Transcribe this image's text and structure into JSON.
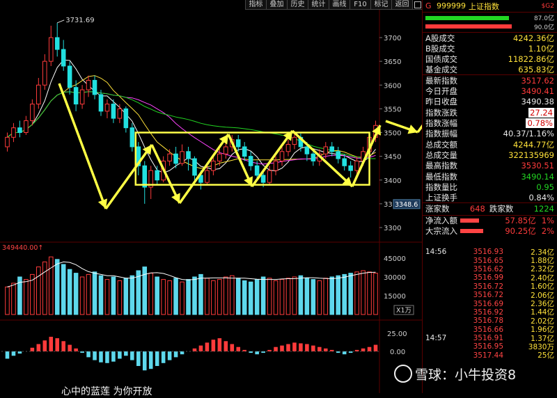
{
  "toolbar": {
    "buttons": [
      "指标",
      "叠加",
      "历史",
      "统计",
      "画线",
      "F10",
      "标记",
      "返回"
    ]
  },
  "chart_data": {
    "type": "candlestick",
    "y_ticks": [
      "3700",
      "3650",
      "3600",
      "3550",
      "3500",
      "3450",
      "3400",
      "3350",
      "3300"
    ],
    "y_values": [
      3700,
      3650,
      3600,
      3550,
      3500,
      3450,
      3400,
      3350,
      3300
    ],
    "high_label": "3731.69",
    "low_label": "3348.6",
    "current_price": 3517.62,
    "box": {
      "top": 3500,
      "bottom": 3390
    },
    "volume_ticks": [
      "45000",
      "30000",
      "15000"
    ],
    "volume_ticks_values": [
      45000,
      30000,
      15000
    ],
    "volume_label": "349440.00↑",
    "volume_unit": "X1万",
    "macd_ticks": [
      "25.00",
      "0.00"
    ],
    "candles": [
      {
        "o": 3470,
        "c": 3490,
        "h": 3500,
        "l": 3460
      },
      {
        "o": 3490,
        "c": 3510,
        "h": 3520,
        "l": 3480
      },
      {
        "o": 3510,
        "c": 3500,
        "h": 3525,
        "l": 3490
      },
      {
        "o": 3500,
        "c": 3525,
        "h": 3535,
        "l": 3495
      },
      {
        "o": 3525,
        "c": 3560,
        "h": 3570,
        "l": 3515
      },
      {
        "o": 3560,
        "c": 3600,
        "h": 3615,
        "l": 3550
      },
      {
        "o": 3600,
        "c": 3650,
        "h": 3665,
        "l": 3590
      },
      {
        "o": 3650,
        "c": 3700,
        "h": 3725,
        "l": 3640
      },
      {
        "o": 3700,
        "c": 3675,
        "h": 3731,
        "l": 3660
      },
      {
        "o": 3675,
        "c": 3640,
        "h": 3695,
        "l": 3630
      },
      {
        "o": 3640,
        "c": 3595,
        "h": 3650,
        "l": 3580
      },
      {
        "o": 3595,
        "c": 3560,
        "h": 3610,
        "l": 3545
      },
      {
        "o": 3560,
        "c": 3590,
        "h": 3600,
        "l": 3550
      },
      {
        "o": 3590,
        "c": 3610,
        "h": 3620,
        "l": 3575
      },
      {
        "o": 3610,
        "c": 3580,
        "h": 3620,
        "l": 3570
      },
      {
        "o": 3580,
        "c": 3545,
        "h": 3590,
        "l": 3535
      },
      {
        "o": 3545,
        "c": 3560,
        "h": 3570,
        "l": 3530
      },
      {
        "o": 3560,
        "c": 3530,
        "h": 3570,
        "l": 3520
      },
      {
        "o": 3530,
        "c": 3550,
        "h": 3560,
        "l": 3520
      },
      {
        "o": 3550,
        "c": 3510,
        "h": 3555,
        "l": 3500
      },
      {
        "o": 3510,
        "c": 3470,
        "h": 3520,
        "l": 3460
      },
      {
        "o": 3470,
        "c": 3430,
        "h": 3480,
        "l": 3410
      },
      {
        "o": 3430,
        "c": 3385,
        "h": 3440,
        "l": 3350
      },
      {
        "o": 3385,
        "c": 3420,
        "h": 3430,
        "l": 3360
      },
      {
        "o": 3420,
        "c": 3400,
        "h": 3430,
        "l": 3390
      },
      {
        "o": 3400,
        "c": 3440,
        "h": 3450,
        "l": 3395
      },
      {
        "o": 3440,
        "c": 3455,
        "h": 3465,
        "l": 3430
      },
      {
        "o": 3455,
        "c": 3435,
        "h": 3470,
        "l": 3425
      },
      {
        "o": 3435,
        "c": 3460,
        "h": 3475,
        "l": 3430
      },
      {
        "o": 3460,
        "c": 3445,
        "h": 3470,
        "l": 3420
      },
      {
        "o": 3445,
        "c": 3410,
        "h": 3450,
        "l": 3400
      },
      {
        "o": 3410,
        "c": 3395,
        "h": 3420,
        "l": 3380
      },
      {
        "o": 3395,
        "c": 3420,
        "h": 3430,
        "l": 3390
      },
      {
        "o": 3420,
        "c": 3440,
        "h": 3450,
        "l": 3410
      },
      {
        "o": 3440,
        "c": 3455,
        "h": 3465,
        "l": 3430
      },
      {
        "o": 3455,
        "c": 3470,
        "h": 3480,
        "l": 3445
      },
      {
        "o": 3470,
        "c": 3485,
        "h": 3495,
        "l": 3460
      },
      {
        "o": 3485,
        "c": 3470,
        "h": 3495,
        "l": 3460
      },
      {
        "o": 3470,
        "c": 3450,
        "h": 3480,
        "l": 3440
      },
      {
        "o": 3450,
        "c": 3430,
        "h": 3460,
        "l": 3420
      },
      {
        "o": 3430,
        "c": 3410,
        "h": 3440,
        "l": 3400
      },
      {
        "o": 3410,
        "c": 3395,
        "h": 3420,
        "l": 3385
      },
      {
        "o": 3395,
        "c": 3420,
        "h": 3430,
        "l": 3390
      },
      {
        "o": 3420,
        "c": 3440,
        "h": 3450,
        "l": 3410
      },
      {
        "o": 3440,
        "c": 3460,
        "h": 3470,
        "l": 3430
      },
      {
        "o": 3460,
        "c": 3475,
        "h": 3485,
        "l": 3450
      },
      {
        "o": 3475,
        "c": 3490,
        "h": 3498,
        "l": 3465
      },
      {
        "o": 3490,
        "c": 3470,
        "h": 3498,
        "l": 3460
      },
      {
        "o": 3470,
        "c": 3455,
        "h": 3480,
        "l": 3440
      },
      {
        "o": 3455,
        "c": 3440,
        "h": 3465,
        "l": 3430
      },
      {
        "o": 3440,
        "c": 3455,
        "h": 3465,
        "l": 3430
      },
      {
        "o": 3455,
        "c": 3470,
        "h": 3480,
        "l": 3445
      },
      {
        "o": 3470,
        "c": 3460,
        "h": 3480,
        "l": 3450
      },
      {
        "o": 3460,
        "c": 3445,
        "h": 3470,
        "l": 3435
      },
      {
        "o": 3445,
        "c": 3430,
        "h": 3455,
        "l": 3420
      },
      {
        "o": 3430,
        "c": 3420,
        "h": 3440,
        "l": 3405
      },
      {
        "o": 3420,
        "c": 3440,
        "h": 3450,
        "l": 3410
      },
      {
        "o": 3440,
        "c": 3460,
        "h": 3470,
        "l": 3430
      },
      {
        "o": 3460,
        "c": 3490,
        "h": 3500,
        "l": 3455
      },
      {
        "o": 3490,
        "c": 3515,
        "h": 3525,
        "l": 3480
      }
    ],
    "volumes": [
      22000,
      25000,
      30000,
      28000,
      32000,
      38000,
      42000,
      46000,
      44000,
      40000,
      36000,
      33000,
      30000,
      32000,
      34000,
      31000,
      28000,
      30000,
      27000,
      29000,
      31000,
      35000,
      38000,
      33000,
      30000,
      28000,
      27000,
      29000,
      26000,
      28000,
      30000,
      32000,
      29000,
      27000,
      28000,
      30000,
      31000,
      29000,
      27000,
      26000,
      28000,
      30000,
      29000,
      27000,
      28000,
      29000,
      30000,
      31000,
      29000,
      28000,
      27000,
      29000,
      30000,
      31000,
      32000,
      33000,
      34000,
      35000,
      34000,
      33000
    ],
    "macd": [
      -10,
      -6,
      -3,
      0,
      5,
      10,
      15,
      20,
      18,
      14,
      9,
      4,
      -2,
      -8,
      -12,
      -15,
      -16,
      -14,
      -10,
      -6,
      -12,
      -20,
      -26,
      -24,
      -20,
      -16,
      -12,
      -8,
      -4,
      0,
      4,
      8,
      12,
      16,
      18,
      14,
      10,
      6,
      2,
      -2,
      -4,
      -2,
      2,
      6,
      8,
      10,
      12,
      11,
      10,
      8,
      6,
      4,
      2,
      -2,
      -4,
      -2,
      2,
      4,
      6,
      9
    ]
  },
  "panel": {
    "title_prefix": "G",
    "title_code": "999999",
    "title_name": "上证指数",
    "title_tag": "$G2",
    "bar1_value": "87.0亿",
    "bar2_value": "90.0亿",
    "rows": [
      {
        "label": "A股成交",
        "value": "4242.36亿",
        "tone": "yellow",
        "key": "a-share-turnover"
      },
      {
        "label": "B股成交",
        "value": "1.10亿",
        "tone": "yellow",
        "key": "b-share-turnover"
      },
      {
        "label": "国债成交",
        "value": "11822.86亿",
        "tone": "yellow",
        "key": "treasury-turnover"
      },
      {
        "label": "基金成交",
        "value": "635.83亿",
        "tone": "yellow",
        "key": "fund-turnover"
      },
      {
        "label": "最新指数",
        "value": "3517.62",
        "tone": "red",
        "key": "latest-index"
      },
      {
        "label": "今日开盘",
        "value": "3490.41",
        "tone": "red",
        "key": "today-open"
      },
      {
        "label": "昨日收盘",
        "value": "3490.38",
        "tone": "white",
        "key": "yesterday-close"
      },
      {
        "label": "指数涨跌",
        "value": "27.24",
        "tone": "red",
        "key": "index-change"
      },
      {
        "label": "指数涨幅",
        "value": "0.78%",
        "tone": "red",
        "key": "index-change-pct"
      },
      {
        "label": "指数振幅",
        "value": "40.37/1.16%",
        "tone": "white",
        "key": "index-amplitude"
      },
      {
        "label": "总成交额",
        "value": "4244.77亿",
        "tone": "yellow",
        "key": "total-turnover"
      },
      {
        "label": "总成交量",
        "value": "322135969",
        "tone": "yellow",
        "key": "total-volume"
      },
      {
        "label": "最高指数",
        "value": "3530.51",
        "tone": "red",
        "key": "highest-index"
      },
      {
        "label": "最低指数",
        "value": "3490.14",
        "tone": "green",
        "key": "lowest-index"
      },
      {
        "label": "指数量比",
        "value": "0.95",
        "tone": "green",
        "key": "volume-ratio"
      },
      {
        "label": "上证换手",
        "value": "0.84%",
        "tone": "white",
        "key": "turnover-rate"
      }
    ],
    "updown": {
      "up_label": "涨家数",
      "up_value": "648",
      "down_label": "跌家数",
      "down_value": "1224"
    },
    "flows": [
      {
        "label": "净流入额",
        "value": "57.85亿",
        "pct": "1%",
        "bar": 0.45
      },
      {
        "label": "大宗流入",
        "value": "90.25亿",
        "pct": "2%",
        "bar": 0.55
      }
    ],
    "ticks": [
      {
        "time": "14:56",
        "price": "3516.93",
        "vol": "2.34亿"
      },
      {
        "time": "",
        "price": "3516.65",
        "vol": "1.88亿"
      },
      {
        "time": "",
        "price": "3516.62",
        "vol": "2.32亿"
      },
      {
        "time": "",
        "price": "3516.99",
        "vol": "2.40亿"
      },
      {
        "time": "",
        "price": "3516.72",
        "vol": "1.60亿"
      },
      {
        "time": "",
        "price": "3516.72",
        "vol": "2.06亿"
      },
      {
        "time": "",
        "price": "3516.69",
        "vol": "2.36亿"
      },
      {
        "time": "",
        "price": "3516.92",
        "vol": "1.44亿"
      },
      {
        "time": "",
        "price": "3516.78",
        "vol": "2.02亿"
      },
      {
        "time": "",
        "price": "3516.66",
        "vol": "1.96亿"
      },
      {
        "time": "14:57",
        "price": "3516.91",
        "vol": "1.37亿"
      },
      {
        "time": "",
        "price": "3516.95",
        "vol": "3830万"
      },
      {
        "time": "",
        "price": "3517.44",
        "vol": "25亿"
      }
    ]
  },
  "watermark": "雪球：小牛投资8",
  "caption": "心中的蓝莲 为你开放"
}
